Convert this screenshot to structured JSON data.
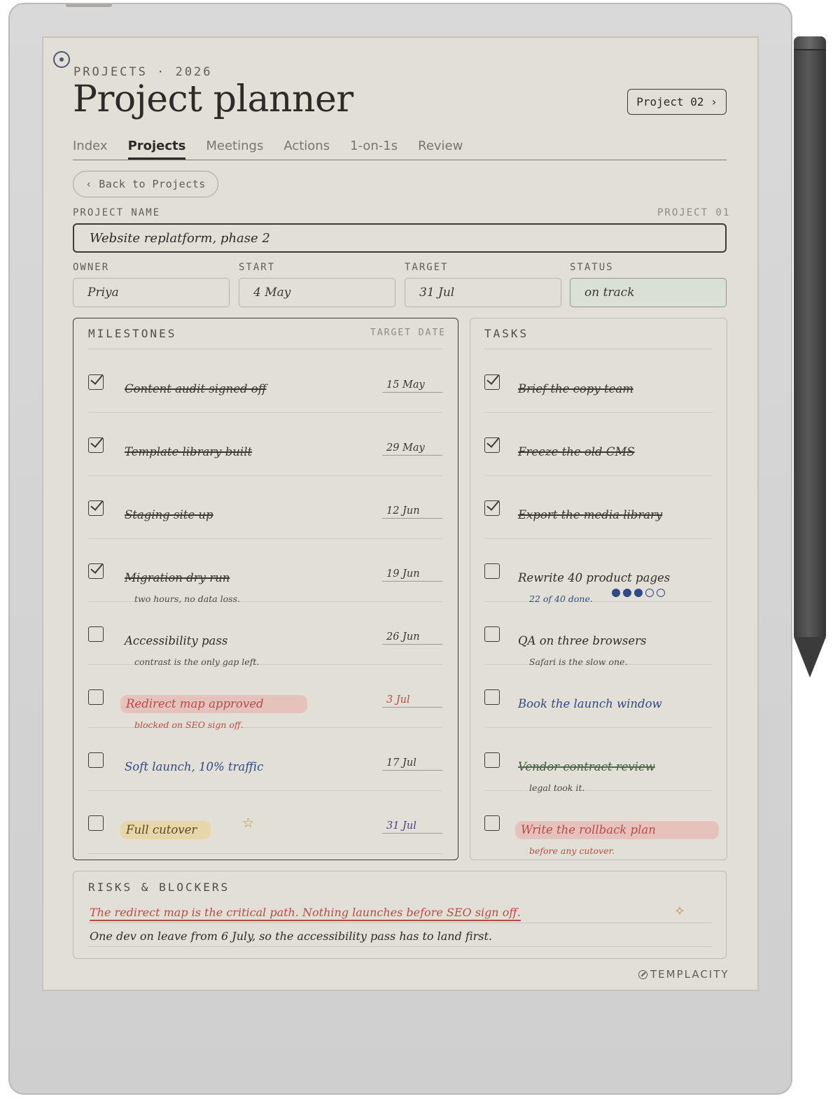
{
  "header": {
    "eyebrow": "PROJECTS · 2026",
    "title": "Project planner",
    "project_button": "Project 02 ›"
  },
  "tabs": [
    {
      "label": "Index",
      "active": false
    },
    {
      "label": "Projects",
      "active": true
    },
    {
      "label": "Meetings",
      "active": false
    },
    {
      "label": "Actions",
      "active": false
    },
    {
      "label": "1-on-1s",
      "active": false
    },
    {
      "label": "Review",
      "active": false
    }
  ],
  "back_button": "‹ Back to Projects",
  "project": {
    "name_label": "PROJECT NAME",
    "number_label": "PROJECT 01",
    "name": "Website replatform, phase 2",
    "fields": {
      "owner_label": "OWNER",
      "owner": "Priya",
      "start_label": "START",
      "start": "4 May",
      "target_label": "TARGET",
      "target": "31 Jul",
      "status_label": "STATUS",
      "status": "on track"
    }
  },
  "milestones": {
    "heading": "MILESTONES",
    "subheading": "TARGET DATE",
    "items": [
      {
        "text": "Content audit signed off",
        "date": "15 May",
        "done": true,
        "note": ""
      },
      {
        "text": "Template library built",
        "date": "29 May",
        "done": true,
        "note": ""
      },
      {
        "text": "Staging site up",
        "date": "12 Jun",
        "done": true,
        "note": ""
      },
      {
        "text": "Migration dry run",
        "date": "19 Jun",
        "done": true,
        "note": "two hours, no data loss."
      },
      {
        "text": "Accessibility pass",
        "date": "26 Jun",
        "done": false,
        "note": "contrast is the only gap left."
      },
      {
        "text": "Redirect map approved",
        "date": "3 Jul",
        "done": false,
        "note": "blocked on SEO sign off."
      },
      {
        "text": "Soft launch, 10% traffic",
        "date": "17 Jul",
        "done": false,
        "note": ""
      },
      {
        "text": "Full cutover",
        "date": "31 Jul",
        "done": false,
        "note": ""
      }
    ]
  },
  "tasks": {
    "heading": "TASKS",
    "items": [
      {
        "text": "Brief the copy team",
        "done": true,
        "note": ""
      },
      {
        "text": "Freeze the old CMS",
        "done": true,
        "note": ""
      },
      {
        "text": "Export the media library",
        "done": true,
        "note": ""
      },
      {
        "text": "Rewrite 40 product pages",
        "done": false,
        "note": "22 of 40 done.",
        "progress_filled": 3,
        "progress_total": 5
      },
      {
        "text": "QA on three browsers",
        "done": false,
        "note": "Safari is the slow one."
      },
      {
        "text": "Book the launch window",
        "done": false,
        "note": ""
      },
      {
        "text": "Vendor contract review",
        "done": false,
        "note": "legal took it."
      },
      {
        "text": "Write the rollback plan",
        "done": false,
        "note": "before any cutover."
      }
    ]
  },
  "risks": {
    "heading": "RISKS & BLOCKERS",
    "lines": [
      "The redirect map is the critical path. Nothing launches before SEO sign off.",
      "One dev on leave from 6 July, so the accessibility pass has to land first."
    ]
  },
  "brand": "TEMPLACITY",
  "icons": {
    "menu": "circle-dot-icon",
    "star": "star-icon",
    "sparkle": "sparkle-icon",
    "brand": "brand-mark-icon"
  },
  "colors": {
    "paper": "#e2dfd6",
    "ink": "#2d2b28",
    "red": "#b94a46",
    "blue": "#2f4a86",
    "green": "#3e5a3c",
    "status_fill": "#dbe0d6"
  }
}
